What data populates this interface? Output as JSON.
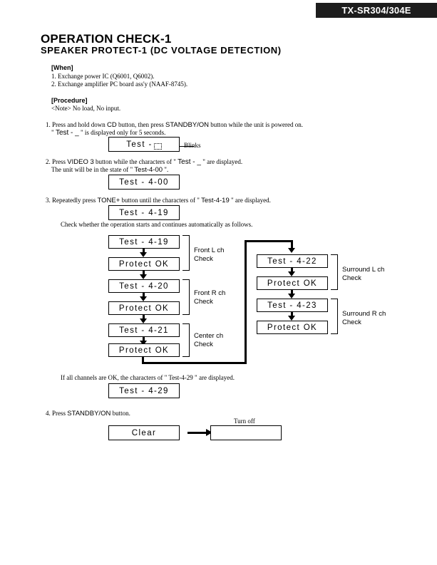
{
  "header": {
    "model_badge": "TX-SR304/304E"
  },
  "titles": {
    "main": "OPERATION CHECK-1",
    "sub": "SPEAKER PROTECT-1 (DC VOLTAGE DETECTION)"
  },
  "when_section": {
    "heading": "[When]",
    "items": [
      "1. Exchange power IC (Q6001, Q6002).",
      "2. Exchange amplifier PC board ass'y (NAAF-8745)."
    ]
  },
  "procedure_section": {
    "heading": "[Procedure]",
    "note": "<Note> No load,  No input."
  },
  "steps": {
    "step1": {
      "line1_a": "1. Press and hold down ",
      "line1_b": "CD",
      "line1_c": " button, then press ",
      "line1_d": "STANDBY/ON",
      "line1_e": " button while the unit is powered on.",
      "line2_a": "\" ",
      "line2_b": "Test - _",
      "line2_c": " \"  is displayed only for 5 seconds.",
      "display_prefix": "Test -",
      "blink_label": "Blinks"
    },
    "step2": {
      "line1_a": "2. Press ",
      "line1_b": "VIDEO 3",
      "line1_c": " button while the characters of \" ",
      "line1_d": "Test - _",
      "line1_e": " \"  are displayed.",
      "line2_a": "The unit will be in the state of \"  ",
      "line2_b": "Test-4-00",
      "line2_c": " \".",
      "display": "Test - 4-00"
    },
    "step3": {
      "line1_a": "3. Repeatedly press ",
      "line1_b": "TONE+",
      "line1_c": " button until the characters of \" ",
      "line1_d": "Test-4-19",
      "line1_e": " \"  are displayed.",
      "display": "Test - 4-19",
      "check_note": "Check whether the operation starts and continues automatically as follows."
    },
    "step4": {
      "line1_a": "4. Press ",
      "line1_b": "STANDBY/ON",
      "line1_c": " button.",
      "clear_display": "Clear",
      "turn_off_label": "Turn off",
      "off_display": ""
    }
  },
  "flow": {
    "left_column": [
      {
        "test": "Test - 4-19",
        "result": "Protect OK",
        "label_line1": "Front L ch",
        "label_line2": "Check"
      },
      {
        "test": "Test - 4-20",
        "result": "Protect OK",
        "label_line1": "Front R ch",
        "label_line2": "Check"
      },
      {
        "test": "Test - 4-21",
        "result": "Protect OK",
        "label_line1": "Center ch",
        "label_line2": "Check"
      }
    ],
    "right_column": [
      {
        "test": "Test - 4-22",
        "result": "Protect OK",
        "label_line1": "Surround L ch",
        "label_line2": "Check"
      },
      {
        "test": "Test - 4-23",
        "result": "Protect OK",
        "label_line1": "Surround R ch",
        "label_line2": "Check"
      }
    ],
    "final_note": "If all channels are OK, the characters of \" Test-4-29 \" are displayed.",
    "final_display": "Test - 4-29"
  }
}
